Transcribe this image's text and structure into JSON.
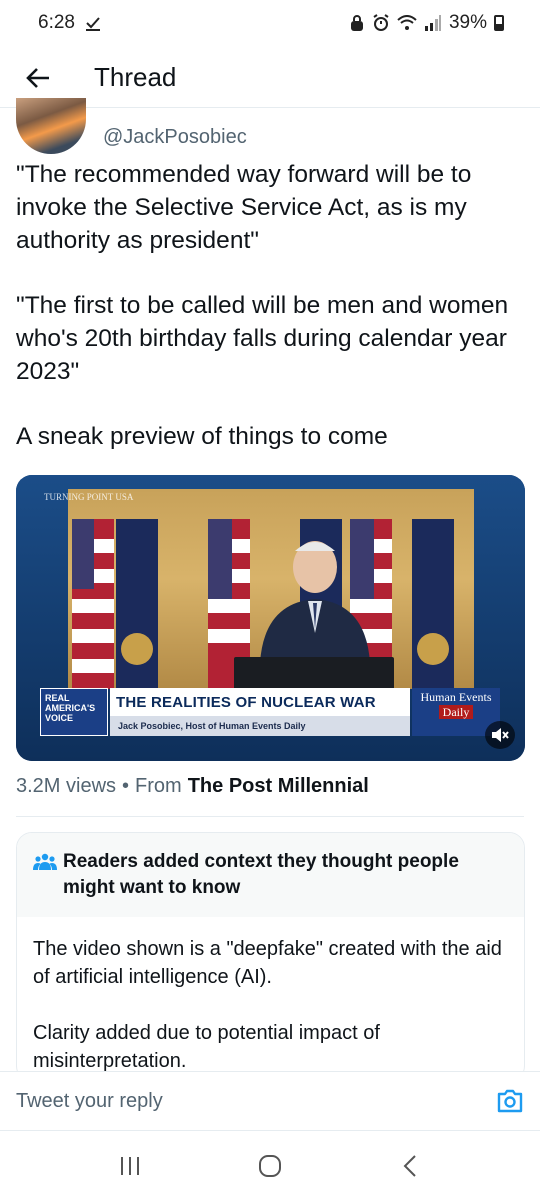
{
  "status_bar": {
    "time": "6:28",
    "battery": "39%"
  },
  "header": {
    "title": "Thread"
  },
  "tweet": {
    "handle": "@JackPosobiec",
    "paragraphs": [
      "\"The recommended way forward will be to invoke the Selective Service Act, as is my authority as president\"",
      "\"The first to be called will be men and women who's 20th birthday falls during calendar year 2023\"",
      "A sneak preview of things to come"
    ],
    "media": {
      "headline": "THE REALITIES OF NUCLEAR WAR",
      "subline": "Jack Posobiec, Host of Human Events Daily",
      "left_logo": "REAL AMERICA'S VOICE",
      "right_logo_top": "Human Events",
      "right_logo_bottom": "Daily",
      "corner_logo": "TURNING POINT USA"
    },
    "views": "3.2M views",
    "separator": "•",
    "from_label": "From",
    "source": "The Post Millennial"
  },
  "community_note": {
    "title": "Readers added context they thought people might want to know",
    "body": [
      "The video shown is a \"deepfake\" created with the aid of artificial intelligence (AI).",
      "Clarity added due to potential impact of misinterpretation."
    ]
  },
  "reply": {
    "placeholder": "Tweet your reply"
  },
  "colors": {
    "accent": "#1d9bf0",
    "text": "#0f1419",
    "secondary": "#536471"
  }
}
